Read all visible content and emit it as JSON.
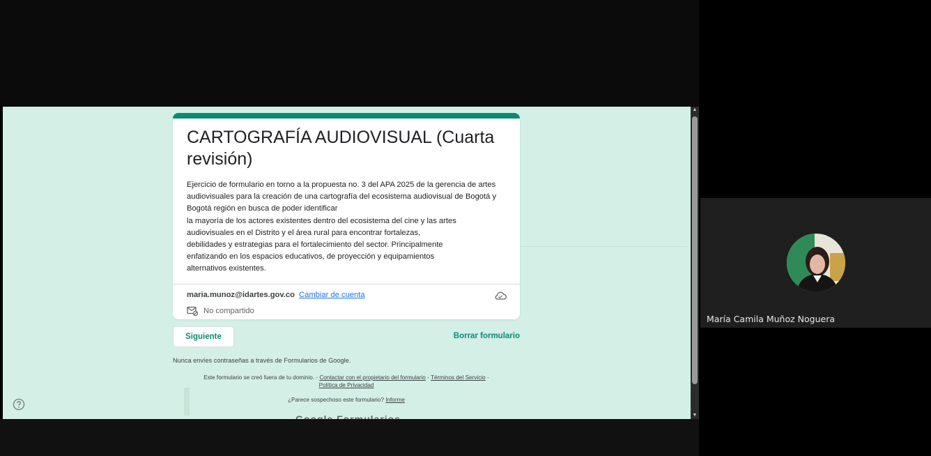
{
  "form": {
    "title": "CARTOGRAFÍA AUDIOVISUAL (Cuarta revisión)",
    "description": "Ejercicio de formulario en torno a la propuesta no. 3 del APA 2025 de la gerencia de artes\naudiovisuales para la  creación de una cartografía del ecosistema audiovisual de Bogotá y\nBogotá región en busca de poder identificar\nla mayoría de los actores existentes dentro del ecosistema del cine y las artes\naudiovisuales en el Distrito y el área rural para encontrar fortalezas,\ndebilidades y estrategias para el fortalecimiento del sector. Principalmente\nenfatizando en los espacios educativos, de proyección y equipamientos\nalternativos existentes.",
    "account_email": "maria.munoz@idartes.gov.co",
    "switch_account_label": "Cambiar de cuenta",
    "shared_status": "No compartido",
    "next_label": "Siguiente",
    "clear_label": "Borrar formulario",
    "password_warning": "Nunca envíes contraseñas a través de Formularios de Google.",
    "domain_note": "Este formulario se creó fuera de tu dominio. -",
    "contact_owner_label": "Contactar con el propietario del formulario",
    "terms_label": "Términos del Servicio",
    "privacy_label": "Política de Privacidad",
    "suspicious_text": "¿Parece sospechoso este formulario?",
    "report_label": "Informe",
    "brand_peek": "Google Formularios"
  },
  "participant": {
    "name": "María Camila Muñoz Noguera"
  },
  "colors": {
    "accent": "#0b8a74",
    "form_background": "#d4efe6",
    "link": "#1a73e8"
  },
  "icons": [
    "cloud-icon",
    "not-shared-icon",
    "help-icon"
  ]
}
